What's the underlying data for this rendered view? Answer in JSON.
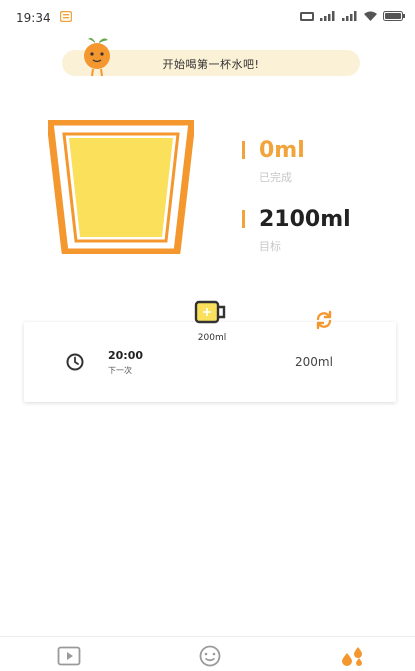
{
  "status_bar": {
    "time": "19:34"
  },
  "banner": {
    "message": "开始喝第一杯水吧!"
  },
  "progress": {
    "completed_value": "0ml",
    "completed_label": "已完成",
    "goal_value": "2100ml",
    "goal_label": "目标",
    "fill_fraction": 0
  },
  "cup_selector": {
    "label": "200ml"
  },
  "reminder": {
    "time": "20:00",
    "time_label": "下一次",
    "amount": "200ml"
  },
  "colors": {
    "accent": "#f2a33a",
    "cup_fill": "#fbe05c",
    "cup_frame": "#f4972f",
    "banner_bg": "#fbf1d6"
  },
  "bottom_nav": {
    "items": [
      {
        "icon": "video-icon",
        "active": false
      },
      {
        "icon": "smile-icon",
        "active": false
      },
      {
        "icon": "drops-icon",
        "active": true
      }
    ]
  }
}
